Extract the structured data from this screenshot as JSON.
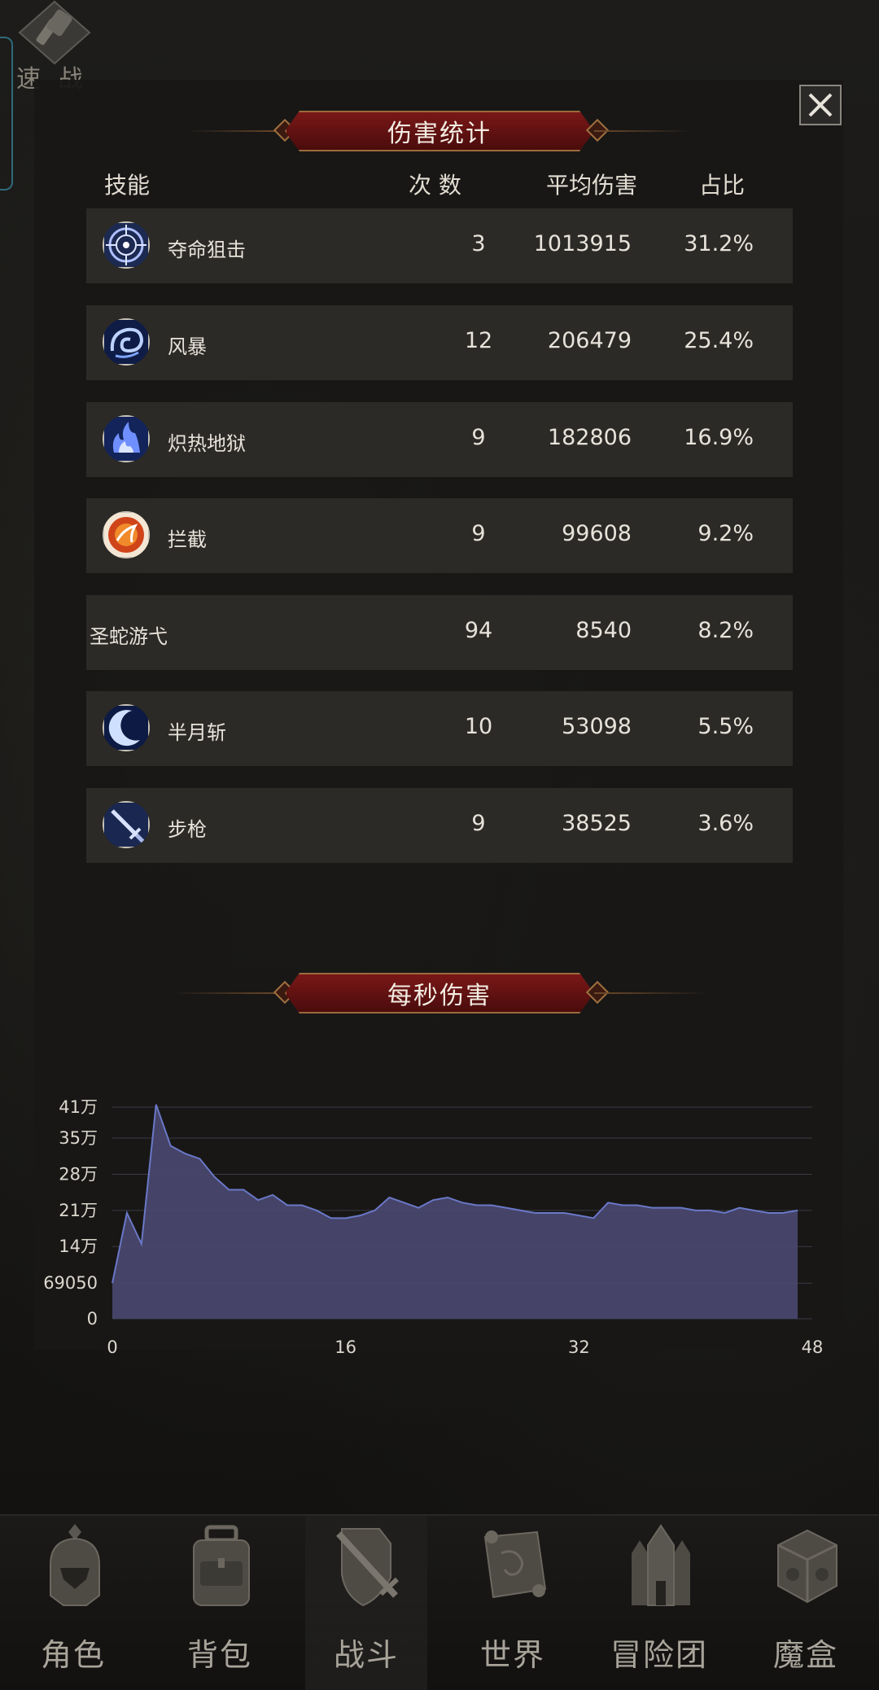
{
  "topbar": {
    "quick_battle_label": "速 战"
  },
  "dialog": {
    "title": "伤害统计",
    "headers": {
      "skill": "技能",
      "count": "次 数",
      "avg": "平均伤害",
      "ratio": "占比"
    },
    "rows": [
      {
        "name": "夺命狙击",
        "count": "3",
        "avg": "1013915",
        "ratio": "31.2%",
        "icon": "target-icon"
      },
      {
        "name": "风暴",
        "count": "12",
        "avg": "206479",
        "ratio": "25.4%",
        "icon": "storm-icon"
      },
      {
        "name": "炽热地狱",
        "count": "9",
        "avg": "182806",
        "ratio": "16.9%",
        "icon": "flame-icon"
      },
      {
        "name": "拦截",
        "count": "9",
        "avg": "99608",
        "ratio": "9.2%",
        "icon": "intercept-icon"
      },
      {
        "name": "圣蛇游弋",
        "count": "94",
        "avg": "8540",
        "ratio": "8.2%",
        "icon": ""
      },
      {
        "name": "半月斩",
        "count": "10",
        "avg": "53098",
        "ratio": "5.5%",
        "icon": "crescent-icon"
      },
      {
        "name": "步枪",
        "count": "9",
        "avg": "38525",
        "ratio": "3.6%",
        "icon": "rifle-icon"
      }
    ],
    "dps_title": "每秒伤害"
  },
  "chart_data": {
    "type": "area",
    "title": "每秒伤害",
    "x": [
      0,
      1,
      2,
      3,
      4,
      5,
      6,
      7,
      8,
      9,
      10,
      11,
      12,
      13,
      14,
      15,
      16,
      17,
      18,
      19,
      20,
      21,
      22,
      23,
      24,
      25,
      26,
      27,
      28,
      29,
      30,
      31,
      32,
      33,
      34,
      35,
      36,
      37,
      38,
      39,
      40,
      41,
      42,
      43,
      44,
      45,
      46,
      47
    ],
    "values": [
      69050,
      205000,
      145000,
      415000,
      335000,
      320000,
      310000,
      275000,
      250000,
      250000,
      230000,
      240000,
      220000,
      220000,
      210000,
      195000,
      195000,
      200000,
      210000,
      235000,
      225000,
      215000,
      230000,
      235000,
      225000,
      220000,
      220000,
      215000,
      210000,
      205000,
      205000,
      205000,
      200000,
      195000,
      225000,
      220000,
      220000,
      215000,
      215000,
      215000,
      210000,
      210000,
      205000,
      215000,
      210000,
      205000,
      205000,
      210000
    ],
    "ytick_labels": [
      "0",
      "69050",
      "14万",
      "21万",
      "28万",
      "35万",
      "41万"
    ],
    "ytick_values": [
      0,
      69050,
      140000,
      210000,
      280000,
      350000,
      410000
    ],
    "xtick_labels": [
      "0",
      "16",
      "32",
      "48"
    ],
    "xlim": [
      0,
      48
    ],
    "ylim": [
      0,
      410000
    ],
    "grid": true,
    "fill_color": "#4a4870",
    "line_color": "#6a78c8"
  },
  "nav": {
    "items": [
      {
        "label": "角色",
        "icon": "helmet-icon"
      },
      {
        "label": "背包",
        "icon": "backpack-icon"
      },
      {
        "label": "战斗",
        "icon": "sword-shield-icon"
      },
      {
        "label": "世界",
        "icon": "map-scroll-icon"
      },
      {
        "label": "冒险团",
        "icon": "castle-icon"
      },
      {
        "label": "魔盒",
        "icon": "magic-cube-icon"
      }
    ],
    "active_index": 2
  },
  "colors": {
    "banner": "#6e1414",
    "row_bg": "#2c2a27",
    "panel": "#181716"
  }
}
